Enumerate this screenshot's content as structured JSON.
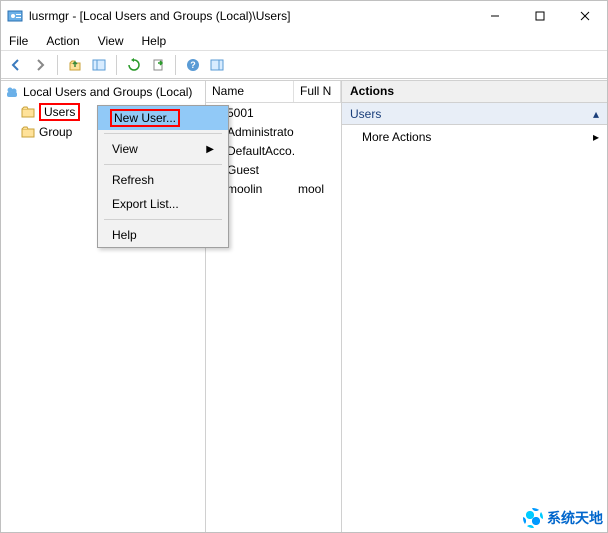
{
  "title": "lusrmgr - [Local Users and Groups (Local)\\Users]",
  "menus": {
    "file": "File",
    "action": "Action",
    "view": "View",
    "help": "Help"
  },
  "tree": {
    "root": "Local Users and Groups (Local)",
    "users": "Users",
    "groups": "Group"
  },
  "list": {
    "col_name": "Name",
    "col_full": "Full N",
    "rows": [
      {
        "name": "5001",
        "full": ""
      },
      {
        "name": "Administrator",
        "full": ""
      },
      {
        "name": "DefaultAcco...",
        "full": ""
      },
      {
        "name": "Guest",
        "full": ""
      },
      {
        "name": "moolin",
        "full": "mool"
      }
    ]
  },
  "actions": {
    "header": "Actions",
    "group": "Users",
    "more": "More Actions"
  },
  "ctx": {
    "newuser": "New User...",
    "view": "View",
    "refresh": "Refresh",
    "export": "Export List...",
    "help": "Help"
  },
  "watermark": "系统天地"
}
